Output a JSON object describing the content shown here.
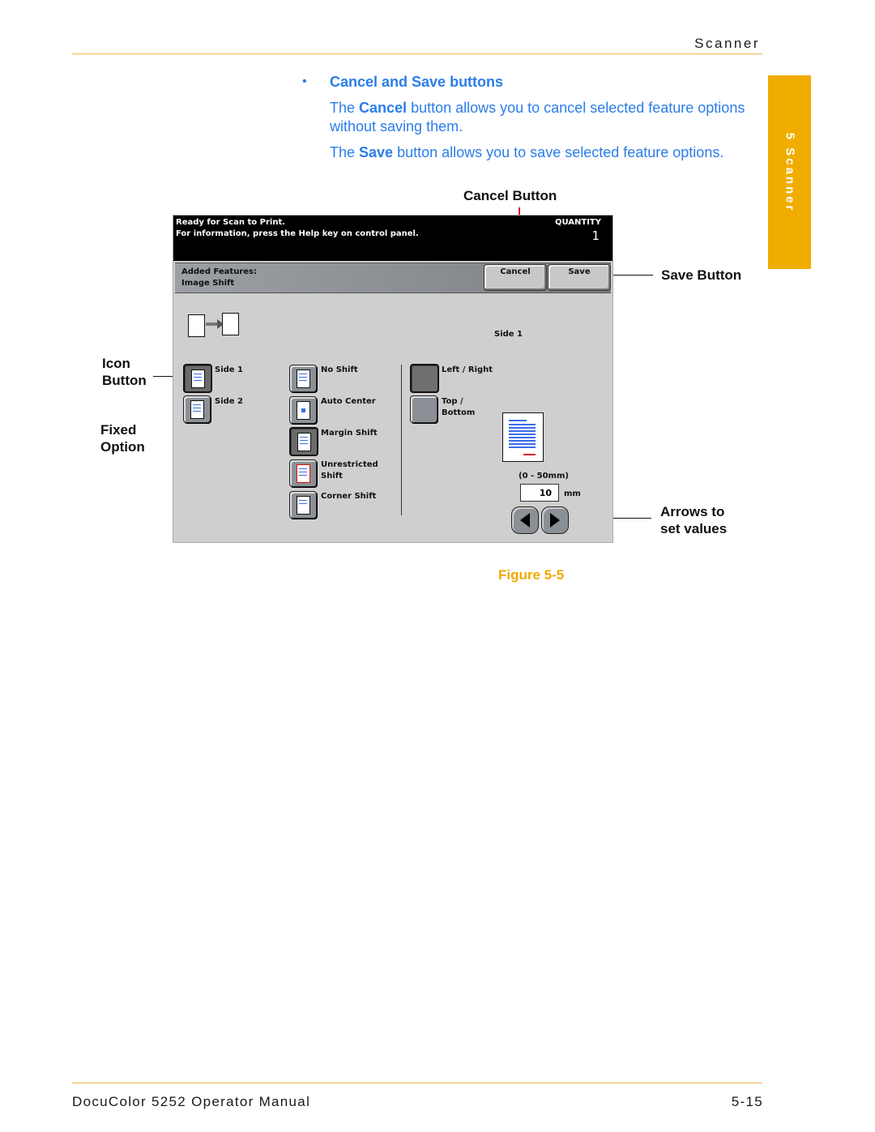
{
  "header": {
    "section": "Scanner"
  },
  "side_tab": {
    "label": "5 Scanner"
  },
  "section": {
    "bullet": "•",
    "title": "Cancel and Save buttons",
    "para1_pre": "The ",
    "para1_bold": "Cancel",
    "para1_post": " button allows you to cancel selected feature options without saving them.",
    "para2_pre": "The ",
    "para2_bold": "Save",
    "para2_post": " button allows you to save selected feature options."
  },
  "callouts": {
    "cancel_button": "Cancel Button",
    "save_button": "Save Button",
    "icon_button_1": "Icon",
    "icon_button_2": "Button",
    "fixed_option_1": "Fixed",
    "fixed_option_2": "Option",
    "arrows_1": "Arrows to",
    "arrows_2": "set values"
  },
  "screen": {
    "message_line1": "Ready for Scan to Print.",
    "message_line2": "For information, press the Help key on control panel.",
    "quantity_label": "QUANTITY",
    "quantity_value": "1",
    "features_label": "Added Features:",
    "features_value": "Image Shift",
    "cancel_label": "Cancel",
    "save_label": "Save",
    "side_heading": "Side 1",
    "sides": [
      {
        "label": "Side 1",
        "selected": true,
        "icon": "page-icon"
      },
      {
        "label": "Side 2",
        "selected": false,
        "icon": "duplex-page-icon"
      }
    ],
    "shift_options": [
      {
        "label": "No Shift",
        "selected": false,
        "icon": "page-icon"
      },
      {
        "label": "Auto Center",
        "selected": false,
        "icon": "auto-center-icon"
      },
      {
        "label": "Margin Shift",
        "selected": true,
        "icon": "margin-shift-icon"
      },
      {
        "label": "Unrestricted Shift",
        "selected": false,
        "icon": "unrestricted-shift-icon"
      },
      {
        "label": "Corner Shift",
        "selected": false,
        "icon": "corner-shift-icon"
      }
    ],
    "directions": [
      {
        "label": "Left / Right",
        "selected": true
      },
      {
        "label": "Top / Bottom",
        "selected": false
      }
    ],
    "range_label": "(0 - 50mm)",
    "value": "10",
    "unit": "mm"
  },
  "figure_caption": "Figure 5-5",
  "footer": {
    "manual": "DocuColor 5252 Operator Manual",
    "page": "5-15"
  }
}
